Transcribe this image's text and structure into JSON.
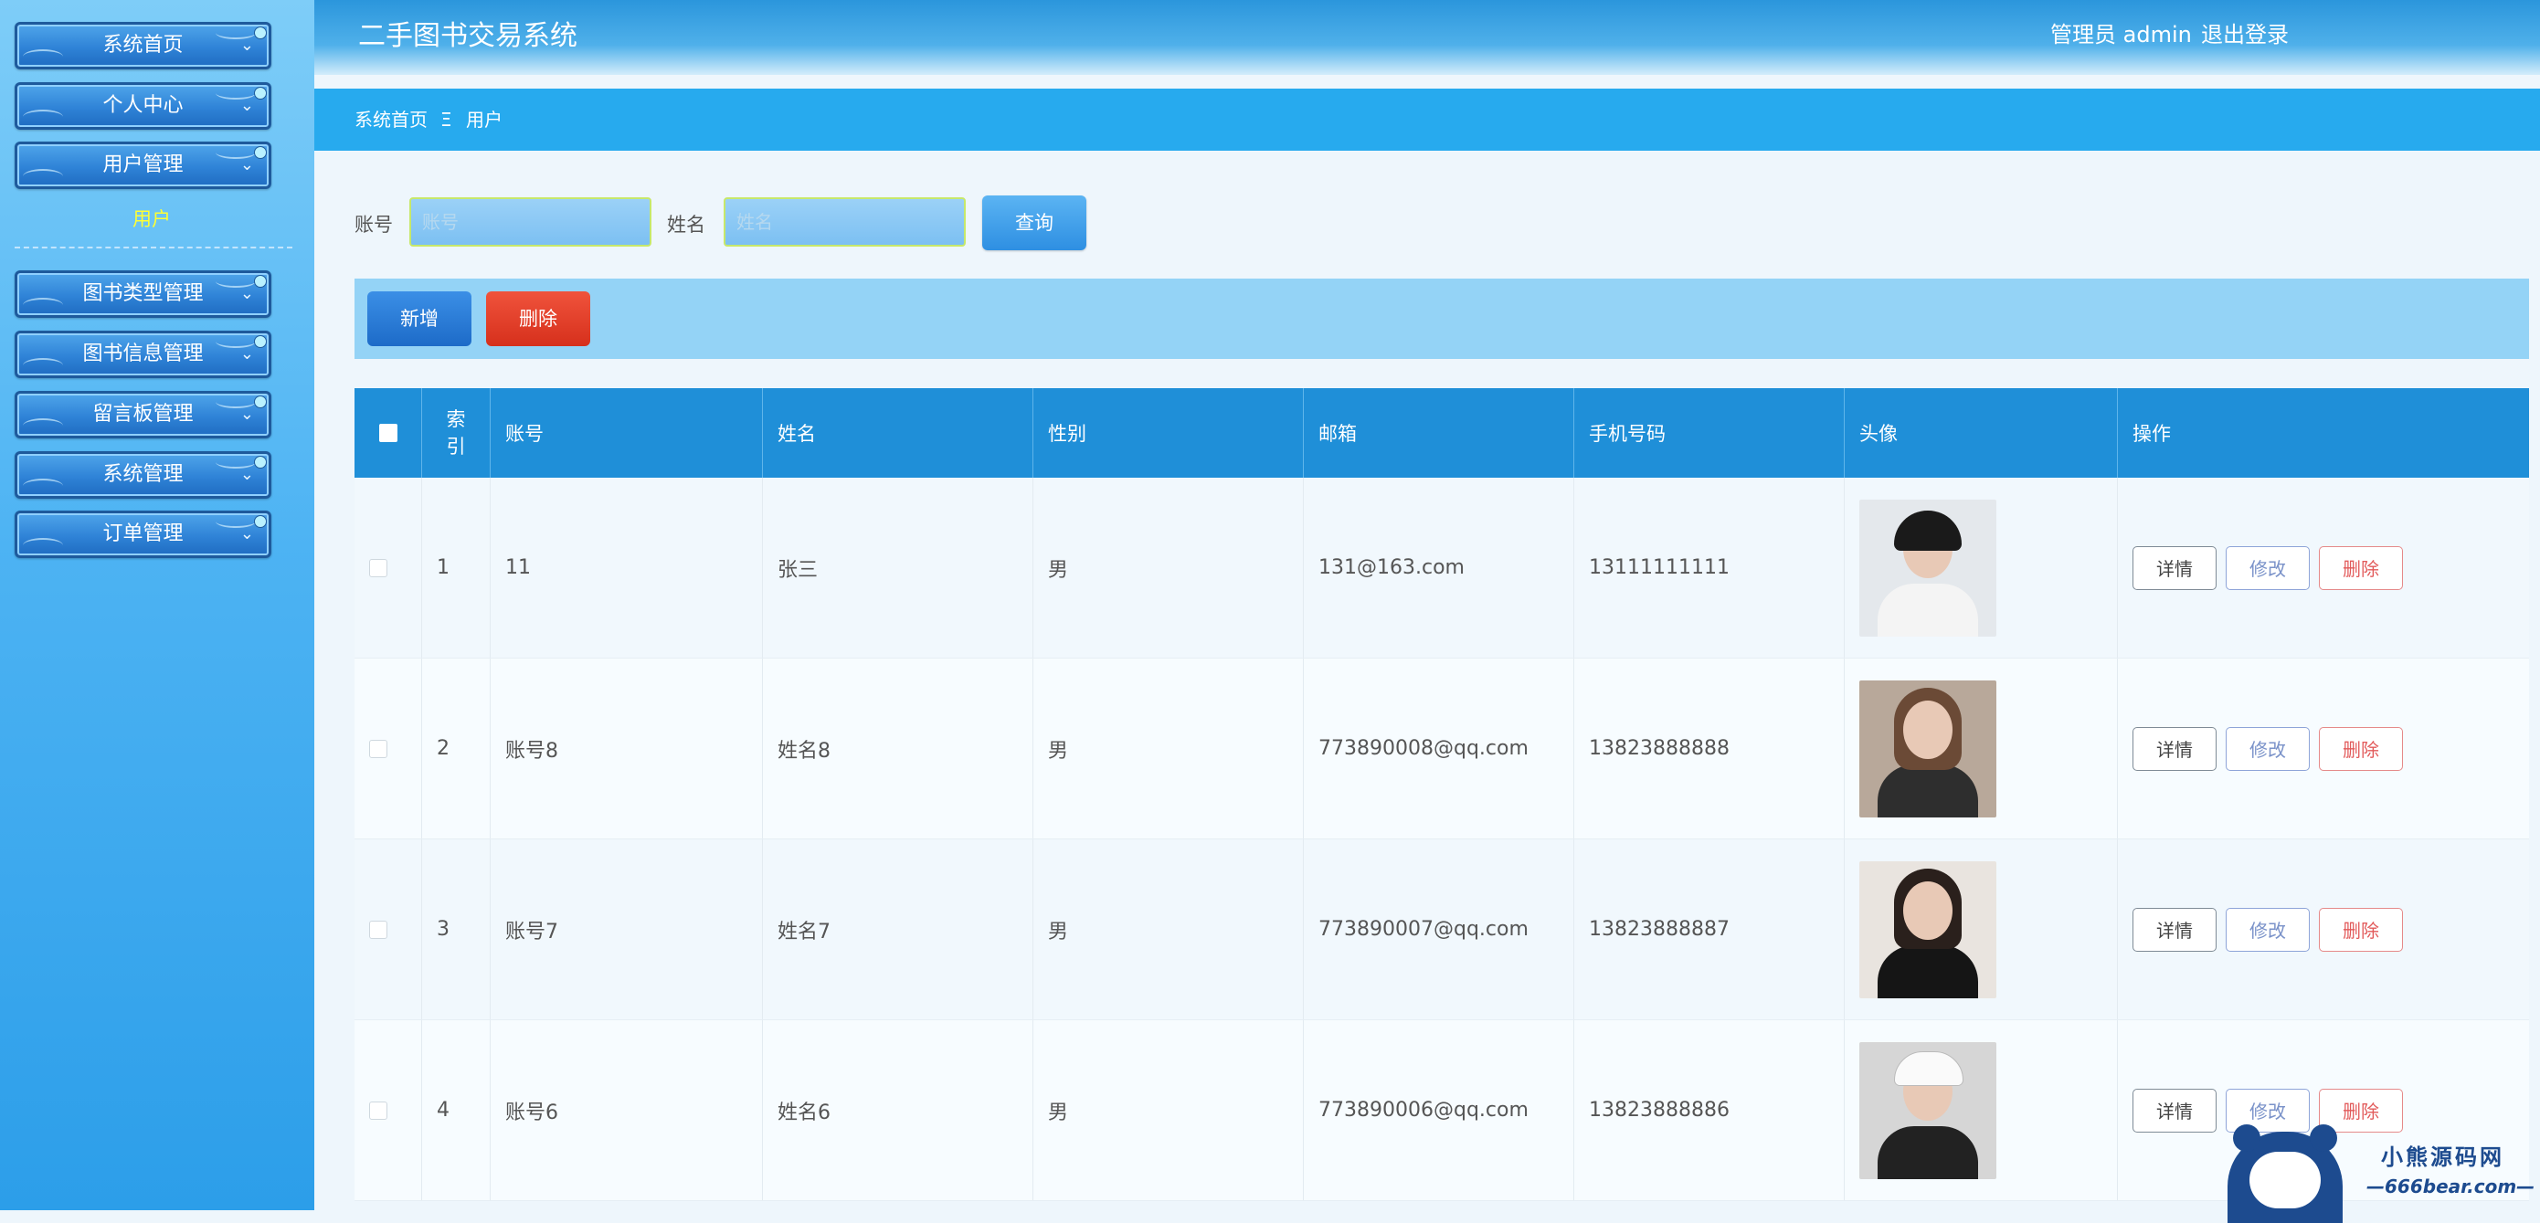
{
  "app": {
    "title": "二手图书交易系统"
  },
  "header": {
    "admin_label": "管理员 admin",
    "logout": "退出登录"
  },
  "sidebar": {
    "items": [
      {
        "label": "系统首页"
      },
      {
        "label": "个人中心"
      },
      {
        "label": "用户管理"
      },
      {
        "label": "图书类型管理"
      },
      {
        "label": "图书信息管理"
      },
      {
        "label": "留言板管理"
      },
      {
        "label": "系统管理"
      },
      {
        "label": "订单管理"
      }
    ],
    "submenu": {
      "label": "用户"
    }
  },
  "breadcrumb": {
    "home": "系统首页",
    "separator": "Ξ",
    "current": "用户"
  },
  "search": {
    "account_label": "账号",
    "account_placeholder": "账号",
    "account_value": "",
    "name_label": "姓名",
    "name_placeholder": "姓名",
    "name_value": "",
    "query_button": "查询"
  },
  "actions": {
    "add": "新增",
    "delete": "删除"
  },
  "table": {
    "headers": {
      "index_line1": "索",
      "index_line2": "引",
      "account": "账号",
      "name": "姓名",
      "gender": "性别",
      "email": "邮箱",
      "phone": "手机号码",
      "avatar": "头像",
      "ops": "操作"
    },
    "op_labels": {
      "detail": "详情",
      "edit": "修改",
      "delete": "删除"
    },
    "rows": [
      {
        "index": "1",
        "account": "11",
        "name": "张三",
        "gender": "男",
        "email": "131@163.com",
        "phone": "13111111111",
        "avatar_color": "#d9dde2"
      },
      {
        "index": "2",
        "account": "账号8",
        "name": "姓名8",
        "gender": "男",
        "email": "773890008@qq.com",
        "phone": "13823888888",
        "avatar_color": "#c9b7a6"
      },
      {
        "index": "3",
        "account": "账号7",
        "name": "姓名7",
        "gender": "男",
        "email": "773890007@qq.com",
        "phone": "13823888887",
        "avatar_color": "#5a4d48"
      },
      {
        "index": "4",
        "account": "账号6",
        "name": "姓名6",
        "gender": "男",
        "email": "773890006@qq.com",
        "phone": "13823888886",
        "avatar_color": "#cfcfcf"
      }
    ]
  },
  "watermark": {
    "text1": "小熊源码网",
    "text2": "—666bear.com—"
  },
  "colors": {
    "header_blue": "#1f8fd8",
    "breadcrumb_blue": "#27aaee",
    "danger": "#d6301c",
    "submenu_yellow": "#ffff33"
  }
}
